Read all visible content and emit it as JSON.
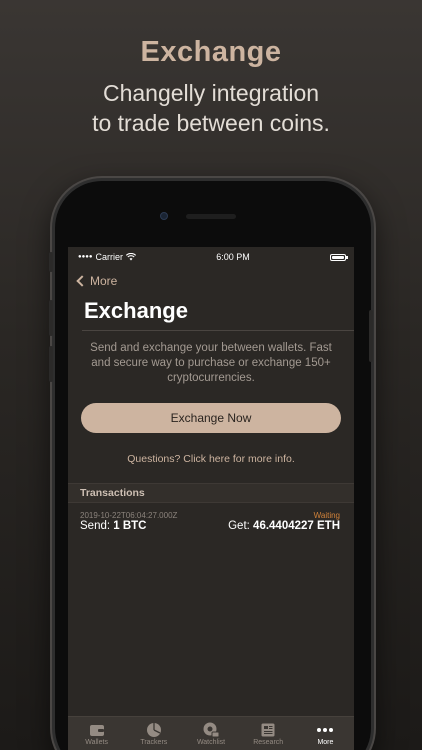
{
  "promo": {
    "title": "Exchange",
    "subtitle_line1": "Changelly integration",
    "subtitle_line2": "to trade between coins."
  },
  "status_bar": {
    "carrier": "Carrier",
    "time": "6:00 PM"
  },
  "nav": {
    "back_label": "More"
  },
  "page": {
    "title": "Exchange",
    "description": "Send and exchange your between wallets. Fast and secure way to purchase or exchange 150+ cryptocurrencies.",
    "exchange_button": "Exchange Now",
    "info_link": "Questions? Click here for more info."
  },
  "transactions": {
    "header": "Transactions",
    "items": [
      {
        "date": "2019-10-22T06:04:27.000Z",
        "status": "Waiting",
        "send": "Send: 1 BTC",
        "get": "Get: 46.4404227 ETH"
      }
    ]
  },
  "tabbar": {
    "items": [
      {
        "label": "Wallets",
        "icon": "wallet-icon"
      },
      {
        "label": "Trackers",
        "icon": "pie-chart-icon"
      },
      {
        "label": "Watchlist",
        "icon": "eye-coin-icon"
      },
      {
        "label": "Research",
        "icon": "newspaper-icon"
      },
      {
        "label": "More",
        "icon": "more-dots-icon"
      }
    ],
    "active": "More"
  },
  "colors": {
    "accent": "#cdb4a0",
    "status_waiting": "#d0823a",
    "screen_bg": "#2b2825"
  }
}
